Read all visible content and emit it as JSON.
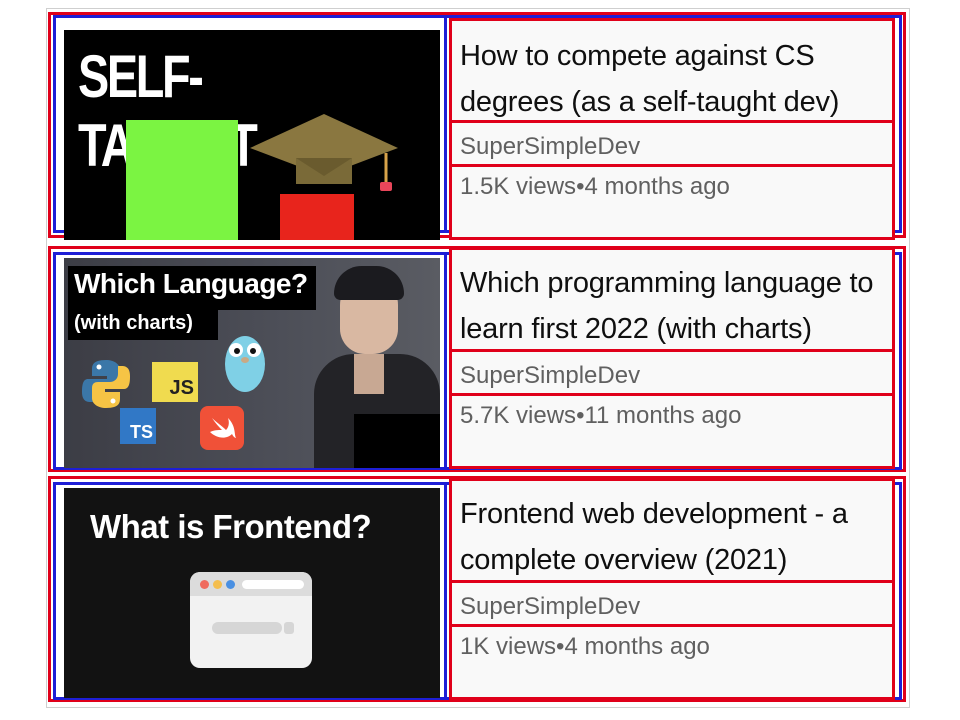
{
  "videos": [
    {
      "title": "How to compete against CS degrees (as a self-taught dev)",
      "channel": "SuperSimpleDev",
      "views": "1.5K views",
      "age": "4 months ago",
      "thumbnail_text": "SELF-TAUGHT"
    },
    {
      "title": "Which programming language to learn first 2022 (with charts)",
      "channel": "SuperSimpleDev",
      "views": "5.7K views",
      "age": "11 months ago",
      "thumbnail_text": "Which Language?",
      "thumbnail_subtext": "(with charts)",
      "thumbnail_badges": [
        "JS",
        "TS"
      ]
    },
    {
      "title": "Frontend web development - a complete overview (2021)",
      "channel": "SuperSimpleDev",
      "views": "1K views",
      "age": "4 months ago",
      "thumbnail_text": "What is Frontend?"
    }
  ],
  "separator": "•",
  "colors": {
    "annotation_red": "#e0001a",
    "annotation_blue": "#1e1ed6",
    "title_text": "#0f0f0f",
    "meta_text": "#606060",
    "info_bg": "#f9f9f9"
  }
}
